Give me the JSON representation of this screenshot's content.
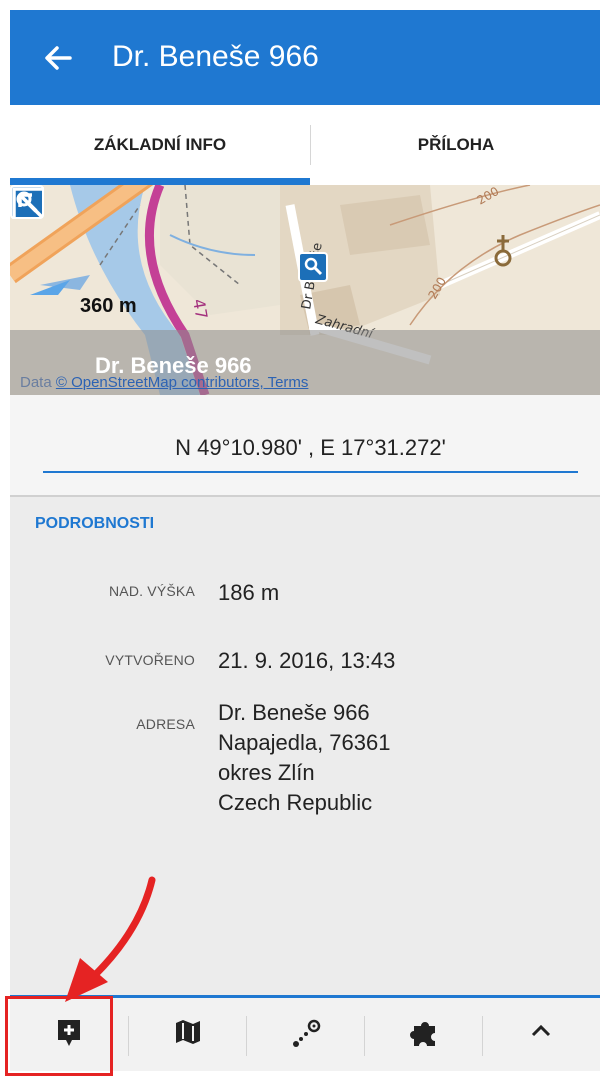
{
  "appbar": {
    "title": "Dr. Beneše 966",
    "back_icon": "arrow-back-icon"
  },
  "tabs": [
    {
      "label": "ZÁKLADNÍ INFO",
      "active": true
    },
    {
      "label": "PŘÍLOHA",
      "active": false
    }
  ],
  "map": {
    "scale": "360 m",
    "road_number": "47",
    "contour_label_1": "200",
    "contour_label_2": "200",
    "street_1": "Dr Beneše",
    "street_2": "Zahradní",
    "poi_title": "Dr. Beneše 966",
    "attribution_prefix": "Data ",
    "attribution_link": "© OpenStreetMap contributors, Terms",
    "icons": [
      "search-poi-icon",
      "expand-arrow-icon"
    ]
  },
  "coordinates": "N 49°10.980' , E 17°31.272'",
  "details": {
    "heading": "PODROBNOSTI",
    "rows": [
      {
        "label": "NAD. VÝŠKA",
        "value": "186 m"
      },
      {
        "label": "VYTVOŘENO",
        "value": "21. 9. 2016, 13:43"
      }
    ],
    "address": {
      "label": "ADRESA",
      "lines": [
        "Dr. Beneše 966",
        "Napajedla, 76361",
        "okres Zlín",
        "Czech Republic"
      ]
    }
  },
  "bottom_bar": {
    "items": [
      "add-note-icon",
      "map-icon",
      "route-points-icon",
      "addons-puzzle-icon",
      "chevron-up-icon"
    ]
  },
  "colors": {
    "accent": "#1f78d1",
    "annotation": "#e52323",
    "background": "#ececec"
  }
}
